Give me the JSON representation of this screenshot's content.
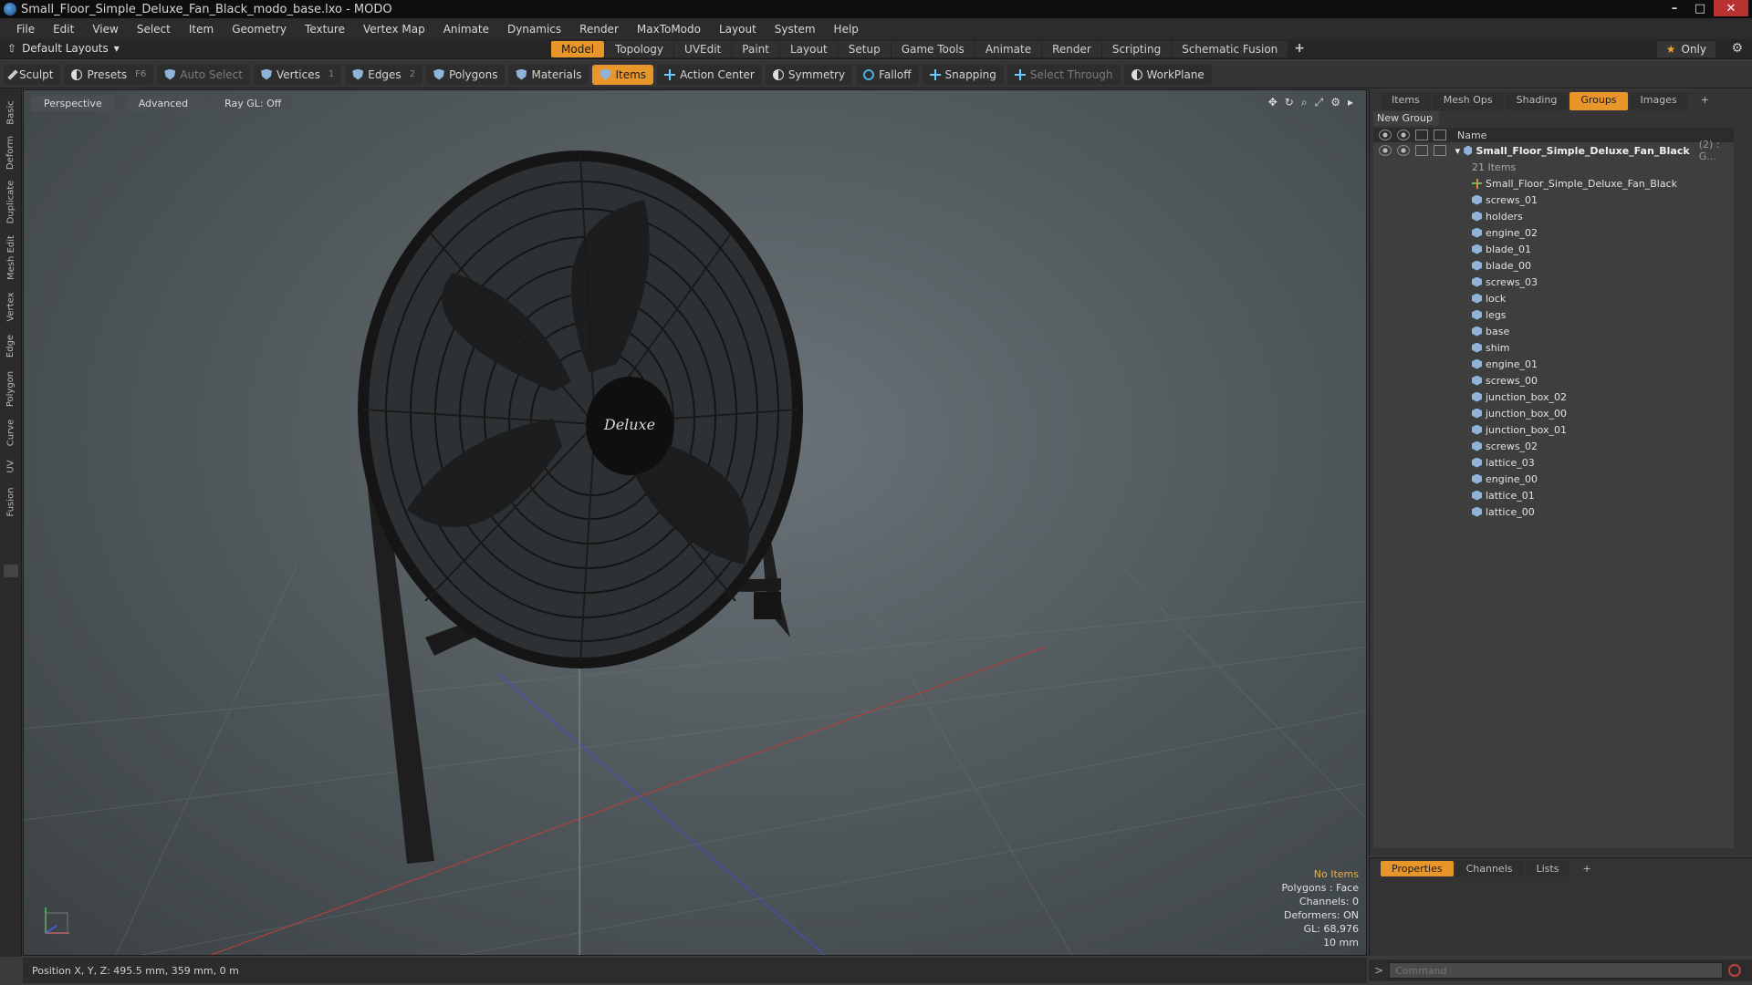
{
  "window": {
    "title": "Small_Floor_Simple_Deluxe_Fan_Black_modo_base.lxo - MODO"
  },
  "menu": [
    "File",
    "Edit",
    "View",
    "Select",
    "Item",
    "Geometry",
    "Texture",
    "Vertex Map",
    "Animate",
    "Dynamics",
    "Render",
    "MaxToModo",
    "Layout",
    "System",
    "Help"
  ],
  "layouts": {
    "selector": "Default Layouts",
    "tabs": [
      "Model",
      "Topology",
      "UVEdit",
      "Paint",
      "Layout",
      "Setup",
      "Game Tools",
      "Animate",
      "Render",
      "Scripting",
      "Schematic Fusion"
    ],
    "active": "Model",
    "only_label": "Only"
  },
  "toolbar": {
    "sculpt": "Sculpt",
    "presets": "Presets",
    "presets_key": "F6",
    "auto_select": "Auto Select",
    "vertices": "Vertices",
    "vertices_key": "1",
    "edges": "Edges",
    "edges_key": "2",
    "polygons": "Polygons",
    "materials": "Materials",
    "items": "Items",
    "action_center": "Action Center",
    "symmetry": "Symmetry",
    "falloff": "Falloff",
    "snapping": "Snapping",
    "select_through": "Select Through",
    "workplane": "WorkPlane"
  },
  "left_tabs": [
    "Basic",
    "Deform",
    "Duplicate",
    "Mesh Edit",
    "Vertex",
    "Edge",
    "Polygon",
    "Curve",
    "UV",
    "Fusion"
  ],
  "viewport": {
    "view": "Perspective",
    "shading": "Advanced",
    "raygl": "Ray GL: Off",
    "info": {
      "status": "No Items",
      "polygons": "Polygons : Face",
      "channels": "Channels: 0",
      "deformers": "Deformers: ON",
      "gl": "GL: 68,976",
      "scale": "10 mm"
    },
    "fan_logo": "Deluxe"
  },
  "right_panel": {
    "tabs": [
      "Items",
      "Mesh Ops",
      "Shading",
      "Groups",
      "Images"
    ],
    "active": "Groups",
    "new_group": "New Group",
    "col_name": "Name",
    "group": {
      "name": "Small_Floor_Simple_Deluxe_Fan_Black",
      "count": "(2) : G...",
      "sub": "21 Items"
    },
    "items": [
      "Small_Floor_Simple_Deluxe_Fan_Black",
      "screws_01",
      "holders",
      "engine_02",
      "blade_01",
      "blade_00",
      "screws_03",
      "lock",
      "legs",
      "base",
      "shim",
      "engine_01",
      "screws_00",
      "junction_box_02",
      "junction_box_00",
      "junction_box_01",
      "screws_02",
      "lattice_03",
      "engine_00",
      "lattice_01",
      "lattice_00"
    ]
  },
  "properties_panel": {
    "tabs": [
      "Properties",
      "Channels",
      "Lists"
    ],
    "active": "Properties"
  },
  "status": {
    "position": "Position X, Y, Z:  495.5 mm, 359 mm, 0 m"
  },
  "command": {
    "placeholder": "Command"
  },
  "colors": {
    "accent": "#e8962a",
    "background": "#353535",
    "viewport": "#555d61"
  }
}
